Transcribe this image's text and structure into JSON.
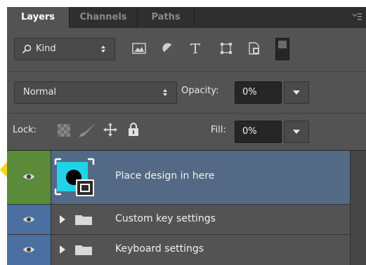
{
  "tabs": [
    {
      "label": "Layers",
      "active": true
    },
    {
      "label": "Channels",
      "active": false
    },
    {
      "label": "Paths",
      "active": false
    }
  ],
  "filter": {
    "search_icon": "search-icon",
    "kind_label": "Kind"
  },
  "blend": {
    "mode": "Normal",
    "opacity_label": "Opacity:",
    "opacity_value": "0%"
  },
  "lock": {
    "label": "Lock:",
    "fill_label": "Fill:",
    "fill_value": "0%"
  },
  "layers": [
    {
      "name": "Place design in here",
      "type": "smart-object",
      "selected": true
    },
    {
      "name": "Custom key settings",
      "type": "group",
      "selected": false
    },
    {
      "name": "Keyboard settings",
      "type": "group",
      "selected": false
    }
  ],
  "colors": {
    "accent_eye_selected": "#5a8a3a",
    "accent_eye": "#4a6fa0",
    "selected_row": "#536985",
    "callout_arrow": "#f7d417"
  }
}
